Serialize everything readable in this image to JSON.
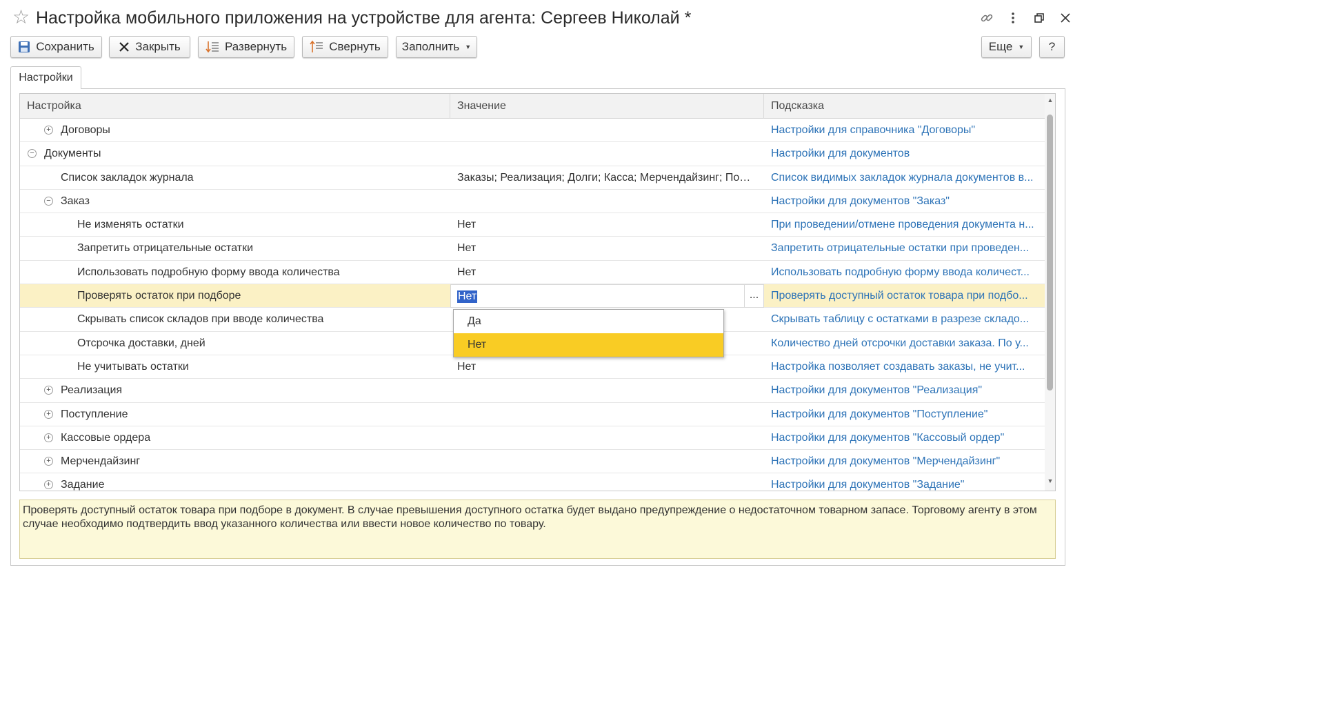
{
  "window": {
    "title": "Настройка мобильного приложения на устройстве для агента: Сергеев Николай *"
  },
  "toolbar": {
    "save_label": "Сохранить",
    "close_label": "Закрыть",
    "expand_label": "Развернуть",
    "collapse_label": "Свернуть",
    "fill_label": "Заполнить",
    "more_label": "Еще",
    "help_label": "?"
  },
  "tabs": [
    {
      "label": "Настройки"
    }
  ],
  "grid": {
    "columns": [
      "Настройка",
      "Значение",
      "Подсказка"
    ],
    "rows": [
      {
        "name": "Договоры",
        "value": "",
        "hint": "Настройки для справочника \"Договоры\""
      },
      {
        "name": "Документы",
        "value": "",
        "hint": "Настройки для документов"
      },
      {
        "name": "Список закладок журнала",
        "value": "Заказы; Реализация; Долги; Касса; Мерчендайзинг; Пос...",
        "hint": "Список видимых закладок журнала документов в..."
      },
      {
        "name": "Заказ",
        "value": "",
        "hint": "Настройки для документов \"Заказ\""
      },
      {
        "name": "Не изменять остатки",
        "value": "Нет",
        "hint": "При проведении/отмене проведения документа н..."
      },
      {
        "name": "Запретить отрицательные остатки",
        "value": "Нет",
        "hint": "Запретить отрицательные остатки при проведен..."
      },
      {
        "name": "Использовать подробную форму ввода количества",
        "value": "Нет",
        "hint": "Использовать подробную форму ввода количест..."
      },
      {
        "name": "Проверять остаток при подборе",
        "value": "Нет",
        "hint": "Проверять доступный остаток товара при подбо..."
      },
      {
        "name": "Скрывать список складов при вводе количества",
        "value": "",
        "hint": "Скрывать таблицу с остатками в разрезе складо..."
      },
      {
        "name": "Отсрочка доставки, дней",
        "value": "",
        "hint": "Количество дней отсрочки доставки заказа. По у..."
      },
      {
        "name": "Не учитывать остатки",
        "value": "Нет",
        "hint": "Настройка позволяет создавать заказы, не учит..."
      },
      {
        "name": "Реализация",
        "value": "",
        "hint": "Настройки для документов \"Реализация\""
      },
      {
        "name": "Поступление",
        "value": "",
        "hint": "Настройки для документов \"Поступление\""
      },
      {
        "name": "Кассовые ордера",
        "value": "",
        "hint": "Настройки для документов \"Кассовый ордер\""
      },
      {
        "name": "Мерчендайзинг",
        "value": "",
        "hint": "Настройки для документов \"Мерчендайзинг\""
      },
      {
        "name": "Задание",
        "value": "",
        "hint": "Настройки для документов \"Задание\""
      }
    ],
    "choice_button_label": "..."
  },
  "dropdown": {
    "options": [
      "Да",
      "Нет"
    ],
    "highlighted": "Нет"
  },
  "description": "Проверять доступный остаток товара при подборе в документ. В случае превышения доступного остатка будет выдано предупреждение о недостаточном товарном запасе. Торговому агенту в этом случае необходимо подтвердить ввод указанного количества или ввести новое количество по товару.",
  "colors": {
    "hint_link": "#2d73b7",
    "selected_row": "#fbf1c5",
    "dropdown_highlight": "#f9cc24",
    "description_bg": "#fcf9d9",
    "text_selection": "#3163c9"
  }
}
